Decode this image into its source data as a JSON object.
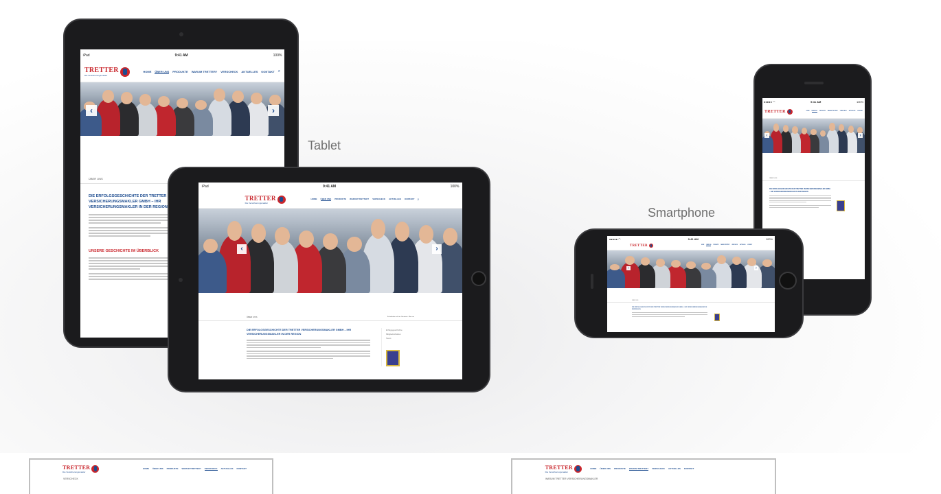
{
  "labels": {
    "tablet": "Tablet",
    "smartphone": "Smartphone"
  },
  "status": {
    "carrier_tablet": "iPad",
    "time": "9:41 AM",
    "battery": "100%",
    "carrier_phone": "●●●●● ◠"
  },
  "site": {
    "logo_word": "TRETTER",
    "logo_sub": "Die Versicherungsmakler",
    "nav": [
      "HOME",
      "ÜBER UNS",
      "PRODUKTE",
      "WARUM TRETTER?",
      "VERSCHECK",
      "AKTUELLES",
      "KONTAKT"
    ],
    "nav_active": "ÜBER UNS",
    "breadcrumb": "ÜBER UNS",
    "breadcrumb_right": "Sie befinden sich hier: Startseite > Über uns",
    "heading_1": "DIE ERFOLGSGESCHICHTE DER TRETTER VERSICHERUNGSMAKLER GMBH – IHR VERSICHERUNGSMAKLER IN DER REGION",
    "heading_2": "UNSERE GESCHICHTE IM ÜBERBLICK",
    "sidebar_links": [
      "Erfolgsgeschichte",
      "Mitgliedschaften",
      "Team"
    ],
    "prev": "‹",
    "next": "›"
  },
  "laptops": {
    "left_nav": [
      "HOME",
      "ÜBER UNS",
      "PRODUKTE",
      "WARUM TRETTER?",
      "VERSCHECK",
      "AKTUELLES",
      "KONTAKT"
    ],
    "left_active": "VERSCHECK",
    "left_page": "VERSCHECK",
    "right_nav": [
      "HOME",
      "ÜBER UNS",
      "PRODUKTE",
      "WARUM TRETTER?",
      "VERSCHECK",
      "AKTUELLES",
      "KONTAKT"
    ],
    "right_active": "WARUM TRETTER?",
    "right_page": "WARUM TRETTER VERSICHERUNGSMAKLER"
  },
  "colors": {
    "brand_red": "#c9262c",
    "brand_blue": "#1d4c8f",
    "device_body": "#1b1b1d"
  }
}
